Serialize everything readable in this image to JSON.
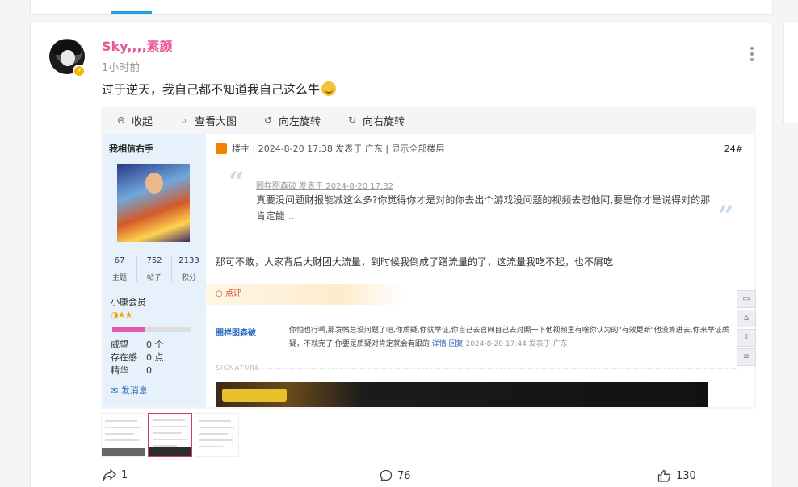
{
  "post": {
    "username": "Sky,,,,素颜",
    "time": "1小时前",
    "text": "过于逆天，我自己都不知道我自己这么牛"
  },
  "viewer": {
    "toolbar": [
      {
        "label": "收起",
        "icon": "collapse-icon"
      },
      {
        "label": "查看大图",
        "icon": "zoom-icon"
      },
      {
        "label": "向左旋转",
        "icon": "rotate-left-icon"
      },
      {
        "label": "向右旋转",
        "icon": "rotate-right-icon"
      }
    ]
  },
  "screenshot": {
    "user_name": "我相信右手",
    "stats": [
      {
        "num": "67",
        "label": "主题"
      },
      {
        "num": "752",
        "label": "帖子"
      },
      {
        "num": "2133",
        "label": "积分"
      }
    ],
    "member_level": "小康会员",
    "stars": "◑★★",
    "props": [
      {
        "key": "威望",
        "value": "0 个"
      },
      {
        "key": "存在感",
        "value": "0 点"
      },
      {
        "key": "精华",
        "value": "0"
      }
    ],
    "send_message": "发消息",
    "header": "楼主 | 2024-8-20 17:38 发表于 广东 | 显示全部楼层",
    "floor": "24#",
    "quote_meta": "圈样图森破 发表于 2024-8-20 17:32",
    "quote_text": "真要没问题财报能减这么多?你觉得你才是对的你去出个游戏没问题的视频去怼他阿,要是你才是说得对的那肯定能 ...",
    "reply_text": "那可不敢，人家背后大财团大流量，到时候我倒成了蹭流量的了，这流量我吃不起，也不屑吃",
    "dianping": "点评",
    "comment_user": "圈样图森破",
    "comment_text": "你怕也行啊,那发帖总没问题了吧,你质疑,你就举证,你自己去官网自己去对照一下他视频里有啥你认为的\"有效更新\"他没算进去,你来举证质疑，不就完了,你要是质疑对肯定就会有跟的",
    "comment_links": "详情 回复",
    "comment_date": "2024-8-20 17:44 发表于:广东",
    "signature": "SIGNATURE"
  },
  "actions": {
    "share_count": "1",
    "comment_count": "76",
    "like_count": "130"
  },
  "colors": {
    "username": "#e65a9a",
    "accent": "#1f9fd8",
    "link": "#2a6bbf"
  }
}
